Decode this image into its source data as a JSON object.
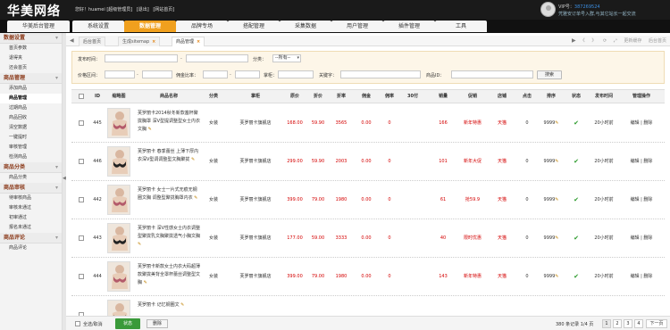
{
  "brand": {
    "logo": "华美网络"
  },
  "topinfo": {
    "greeting": "您好！huamei [超级管理员]",
    "logout": "[退出]",
    "home": "[网站首页]"
  },
  "user": {
    "vip_label": "VIP号：",
    "vip_number": "387269524",
    "notice": "凭雅安订单号入群,与其它站长一起交流"
  },
  "nav": {
    "tabs": [
      "华美后台管理",
      "系统设置",
      "数据管理",
      "品牌专场",
      "搭配管理",
      "采集数据",
      "用户管理",
      "插件管理",
      "工具"
    ],
    "active_index": 2
  },
  "sidebar": {
    "groups": [
      {
        "title": "数据设置",
        "items": [
          "首页参数",
          "退得夹",
          "还会首页"
        ]
      },
      {
        "title": "商品管理",
        "items": [
          "添加商品",
          "商品管理",
          "过期商品",
          "商品回收",
          "清空数据",
          "一键提时",
          "审核管理",
          "检测商品"
        ]
      },
      {
        "title": "商品分类",
        "items": [
          "商品分类"
        ]
      },
      {
        "title": "商品审核",
        "items": [
          "待审核商品",
          "审核未通过",
          "初审通过",
          "报名未通过"
        ]
      },
      {
        "title": "商品评论",
        "items": [
          "商品评论"
        ]
      }
    ],
    "active_item": "商品管理",
    "splitter_glyph": "◀"
  },
  "pagetabs": {
    "left_arrow": "◀",
    "right_arrow": "▶",
    "tabs": [
      "后台首页",
      "生成sitemap",
      "商品管理"
    ],
    "close_glyph": "×",
    "tools": [
      "《",
      "》",
      "⟳",
      "⤢",
      "更新缓存",
      "后台首页"
    ]
  },
  "filter": {
    "publish_time_label": "发布时间：",
    "category_label": "分类：",
    "category_value": "--所有--",
    "price_label": "价格区间：",
    "commission_label": "佣金比率：",
    "shop_label": "掌柜：",
    "keyword_label": "关键字：",
    "item_id_label": "商品ID：",
    "search_button": "搜索",
    "sep": "-"
  },
  "table": {
    "headers": [
      "ID",
      "缩略图",
      "商品名称",
      "分类",
      "掌柜",
      "原价",
      "折价",
      "折率",
      "佣金",
      "佣率",
      "30付",
      "销量",
      "促销",
      "店铺",
      "点击",
      "排序",
      "状态",
      "发布时间",
      "管理操作"
    ],
    "rows": [
      {
        "id": "445",
        "name": "芙罗丽卡2014秋冬新款塞杯聚拢胸罩 深V型提调整型女士内衣 文胸",
        "category": "女装",
        "shop": "芙罗丽卡旗舰店",
        "orig": "168.00",
        "price": "59.90",
        "rate": "3565",
        "comm": "0.00",
        "commrate": "0",
        "sales30": "",
        "sales": "166",
        "promo": "新年特惠",
        "store": "天猫",
        "clicks": "0",
        "sort": "9999",
        "status": "✔",
        "time": "20小时前",
        "ops": "编辑 | 删除"
      },
      {
        "id": "446",
        "name": "芙罗丽卡 春季蕾丝 上薄下厚内衣深V型调调整型文胸聚拢",
        "category": "女装",
        "shop": "芙罗丽卡旗舰店",
        "orig": "299.00",
        "price": "59.90",
        "rate": "2003",
        "comm": "0.00",
        "commrate": "0",
        "sales30": "",
        "sales": "101",
        "promo": "新年大促",
        "store": "天猫",
        "clicks": "0",
        "sort": "9999",
        "status": "✔",
        "time": "20小时前",
        "ops": "编辑 | 删除"
      },
      {
        "id": "442",
        "name": "芙罗丽卡 女士一片式无痕无钢圈文胸 调整型聚拢胸罩内衣",
        "category": "女装",
        "shop": "芙罗丽卡旗舰店",
        "orig": "399.00",
        "price": "79.00",
        "rate": "1980",
        "comm": "0.00",
        "commrate": "0",
        "sales30": "",
        "sales": "61",
        "promo": "抢59.9",
        "store": "天猫",
        "clicks": "0",
        "sort": "9999",
        "status": "✔",
        "time": "20小时前",
        "ops": "编辑 | 删除"
      },
      {
        "id": "443",
        "name": "芙罗丽卡 深V性感女士内衣调整型聚拢乳文胸聚拢透气小胸文胸",
        "category": "女装",
        "shop": "芙罗丽卡旗舰店",
        "orig": "177.00",
        "price": "59.00",
        "rate": "3333",
        "comm": "0.00",
        "commrate": "0",
        "sales30": "",
        "sales": "40",
        "promo": "限时优惠",
        "store": "天猫",
        "clicks": "0",
        "sort": "9999",
        "status": "✔",
        "time": "20小时前",
        "ops": "编辑 | 删除"
      },
      {
        "id": "444",
        "name": "芙罗丽卡新款女士内衣大码超薄款聚拢美背全罩杯蕾丝调整型文胸",
        "category": "女装",
        "shop": "芙罗丽卡旗舰店",
        "orig": "399.00",
        "price": "79.00",
        "rate": "1980",
        "comm": "0.00",
        "commrate": "0",
        "sales30": "",
        "sales": "143",
        "promo": "新年特惠",
        "store": "天猫",
        "clicks": "0",
        "sort": "9999",
        "status": "✔",
        "time": "20小时前",
        "ops": "编辑 | 删除"
      }
    ],
    "partial_row_text": "芙罗丽卡 记忆钢圈文"
  },
  "footer": {
    "select_all": "全选/取消",
    "status_button": "状态",
    "delete_button": "删除",
    "count_text": "380 条记录 1/4 页",
    "pages": [
      "1",
      "2",
      "3",
      "4"
    ],
    "next": "下一页"
  }
}
